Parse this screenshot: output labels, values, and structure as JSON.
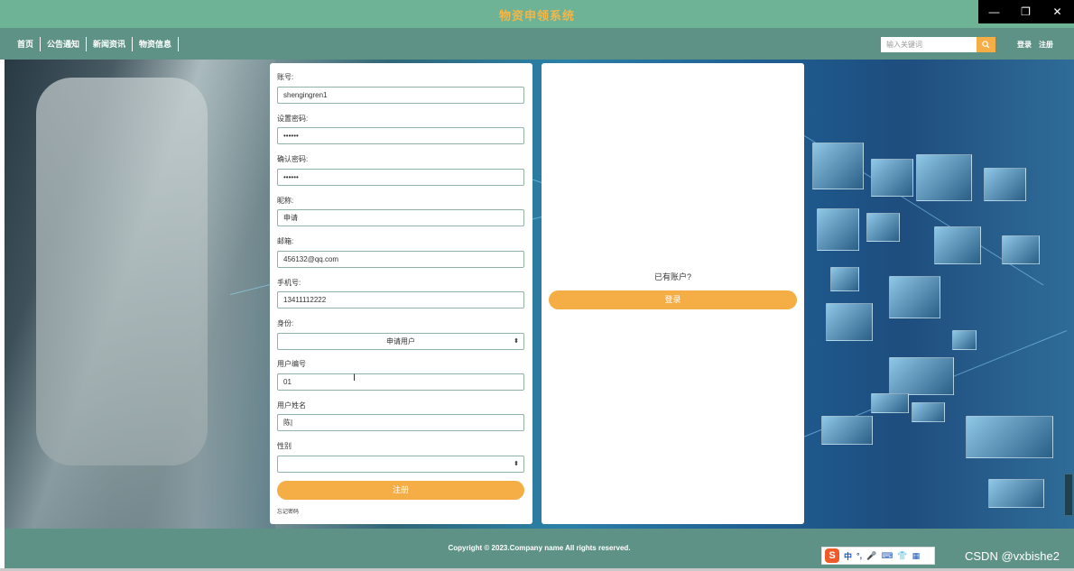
{
  "window": {
    "title": "物资申领系统",
    "controls": [
      "minimize-icon",
      "restore-icon",
      "close-icon"
    ]
  },
  "nav": {
    "items": [
      "首页",
      "公告通知",
      "新闻资讯",
      "物资信息"
    ],
    "search_placeholder": "输入关键词",
    "auth_login": "登录",
    "auth_register": "注册"
  },
  "register_form": {
    "fields": [
      {
        "label": "账号:",
        "value": "shengingren1"
      },
      {
        "label": "设置密码:",
        "value": "••••••"
      },
      {
        "label": "确认密码:",
        "value": "••••••"
      },
      {
        "label": "昵称:",
        "value": "申请"
      },
      {
        "label": "邮箱:",
        "value": "456132@qq.com"
      },
      {
        "label": "手机号:",
        "value": "13411112222"
      },
      {
        "label": "身份:",
        "value": "申请用户"
      },
      {
        "label": "用户编号",
        "value": "01"
      },
      {
        "label": "用户姓名",
        "value": "陈|"
      },
      {
        "label": "性别",
        "value": ""
      }
    ],
    "submit_label": "注册",
    "forgot_label": "忘记密码"
  },
  "login_panel": {
    "prompt": "已有账户?",
    "login_label": "登录"
  },
  "footer": {
    "copyright": "Copyright © 2023.Company name All rights reserved."
  },
  "ime": {
    "logo": "S",
    "items": [
      "中",
      "°,",
      "🎤",
      "⌨",
      "👕",
      "▦"
    ]
  },
  "watermark": "CSDN @vxbishe2",
  "colors": {
    "titlebar": "#6fb397",
    "nav": "#5e9286",
    "accent": "#f5ad45",
    "title_text": "#f3b648"
  }
}
